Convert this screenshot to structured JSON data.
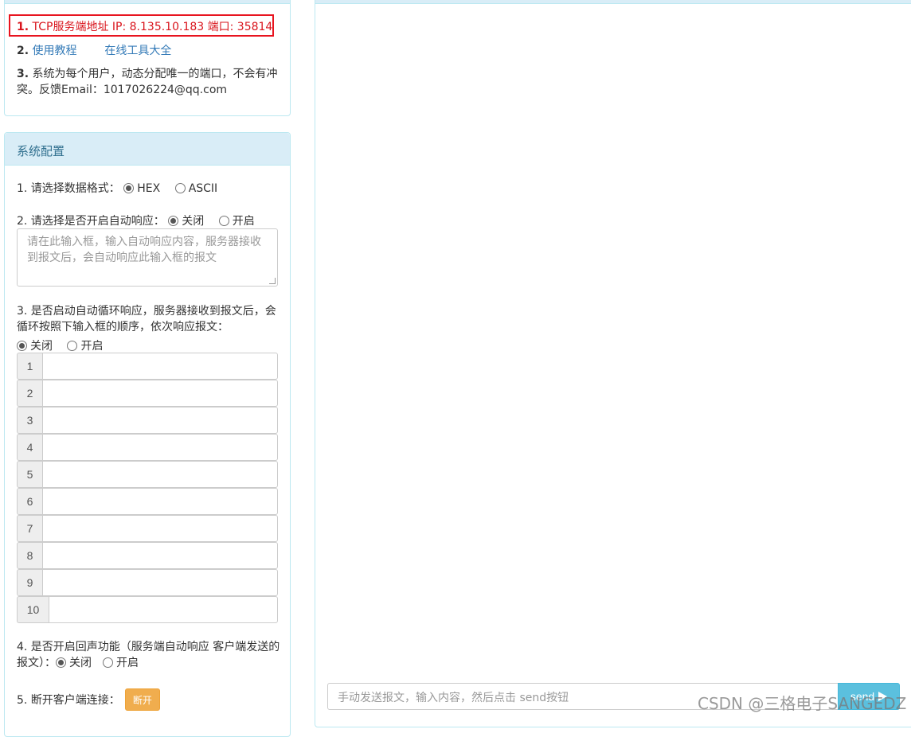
{
  "info": {
    "line1_num": "1.",
    "line1_text": "TCP服务端地址 IP: 8.135.10.183 端口: 35814",
    "line2_num": "2.",
    "tutorial_link": "使用教程",
    "tools_link": "在线工具大全",
    "line3_num": "3.",
    "line3_text": "系统为每个用户，动态分配唯一的端口，不会有冲突。反馈Email：1017026224@qq.com"
  },
  "config": {
    "heading": "系统配置",
    "q1_label": "1. 请选择数据格式：",
    "q1_options": [
      "HEX",
      "ASCII"
    ],
    "q1_selected": "HEX",
    "q2_label": "2. 请选择是否开启自动响应：",
    "q2_options": [
      "关闭",
      "开启"
    ],
    "q2_selected": "关闭",
    "q2_placeholder": "请在此输入框，输入自动响应内容，服务器接收到报文后，会自动响应此输入框的报文",
    "q3_label": "3. 是否启动自动循环响应，服务器接收到报文后，会循环按照下输入框的顺序，依次响应报文：",
    "q3_options": [
      "关闭",
      "开启"
    ],
    "q3_selected": "关闭",
    "loop_inputs": [
      "1",
      "2",
      "3",
      "4",
      "5",
      "6",
      "7",
      "8",
      "9",
      "10"
    ],
    "q4_label": "4. 是否开启回声功能（服务端自动响应 客户端发送的报文）：",
    "q4_options": [
      "关闭",
      "开启"
    ],
    "q4_selected": "关闭",
    "q5_label": "5. 断开客户端连接：",
    "disconnect_button": "断开"
  },
  "main": {
    "send_placeholder": "手动发送报文，输入内容，然后点击 send按钮",
    "send_button": "send",
    "send_icon": "send-icon"
  },
  "watermark": "CSDN @三格电子SANGEDZ"
}
